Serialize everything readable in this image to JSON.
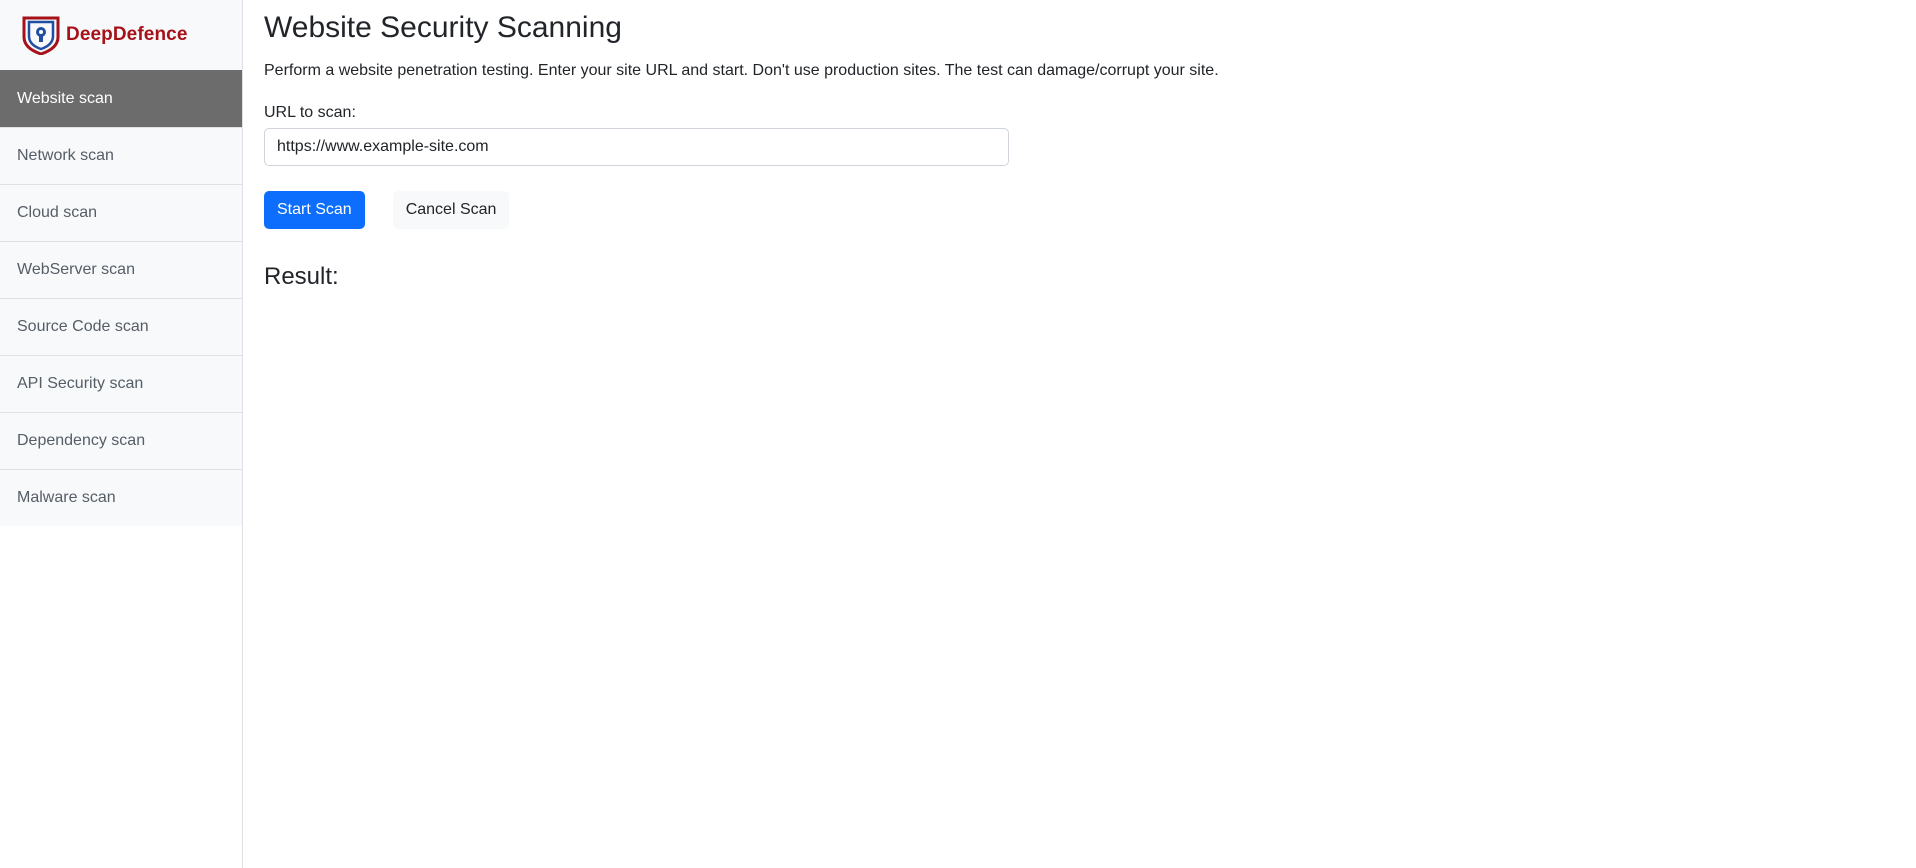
{
  "brand": {
    "name": "DeepDefence",
    "logo_icon": "shield-lock-icon",
    "colors": {
      "primary": "#a6121a",
      "secondary": "#1f4fa3"
    }
  },
  "sidebar": {
    "items": [
      {
        "label": "Website scan",
        "active": true
      },
      {
        "label": "Network scan",
        "active": false
      },
      {
        "label": "Cloud scan",
        "active": false
      },
      {
        "label": "WebServer scan",
        "active": false
      },
      {
        "label": "Source Code scan",
        "active": false
      },
      {
        "label": "API Security scan",
        "active": false
      },
      {
        "label": "Dependency scan",
        "active": false
      },
      {
        "label": "Malware scan",
        "active": false
      }
    ]
  },
  "main": {
    "title": "Website Security Scanning",
    "description": "Perform a website penetration testing. Enter your site URL and start. Don't use production sites. The test can damage/corrupt your site.",
    "url_label": "URL to scan:",
    "url_value": "https://www.example-site.com",
    "start_button": "Start Scan",
    "cancel_button": "Cancel Scan",
    "result_title": "Result:"
  },
  "colors": {
    "accent": "#0d6efd",
    "active_nav": "#6c6c6c"
  }
}
